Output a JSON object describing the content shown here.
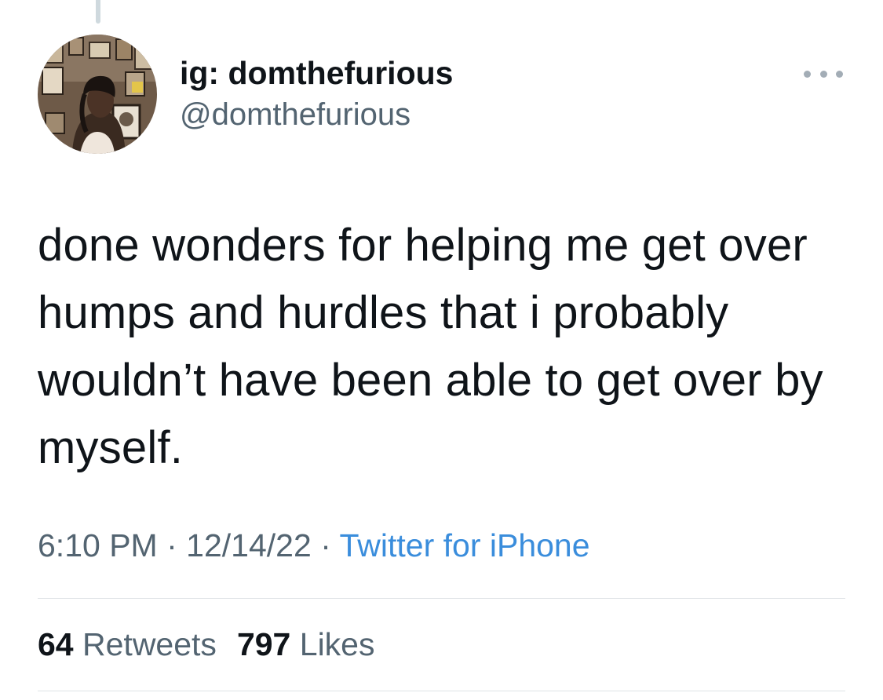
{
  "author": {
    "display_name": "ig: domthefurious",
    "handle": "@domthefurious"
  },
  "tweet": {
    "text": "done wonders for helping me get over humps and hurdles that i probably wouldn’t have been able to get over by myself."
  },
  "meta": {
    "time": "6:10 PM",
    "separator": "·",
    "date": "12/14/22",
    "source": "Twitter for iPhone"
  },
  "stats": {
    "retweets_count": "64",
    "retweets_label": "Retweets",
    "likes_count": "797",
    "likes_label": "Likes"
  },
  "icons": {
    "more": "more-horizontal-icon"
  },
  "colors": {
    "text_primary": "#0f1419",
    "text_secondary": "#536471",
    "link": "#3a8ddc",
    "divider": "#dfe3e6"
  }
}
